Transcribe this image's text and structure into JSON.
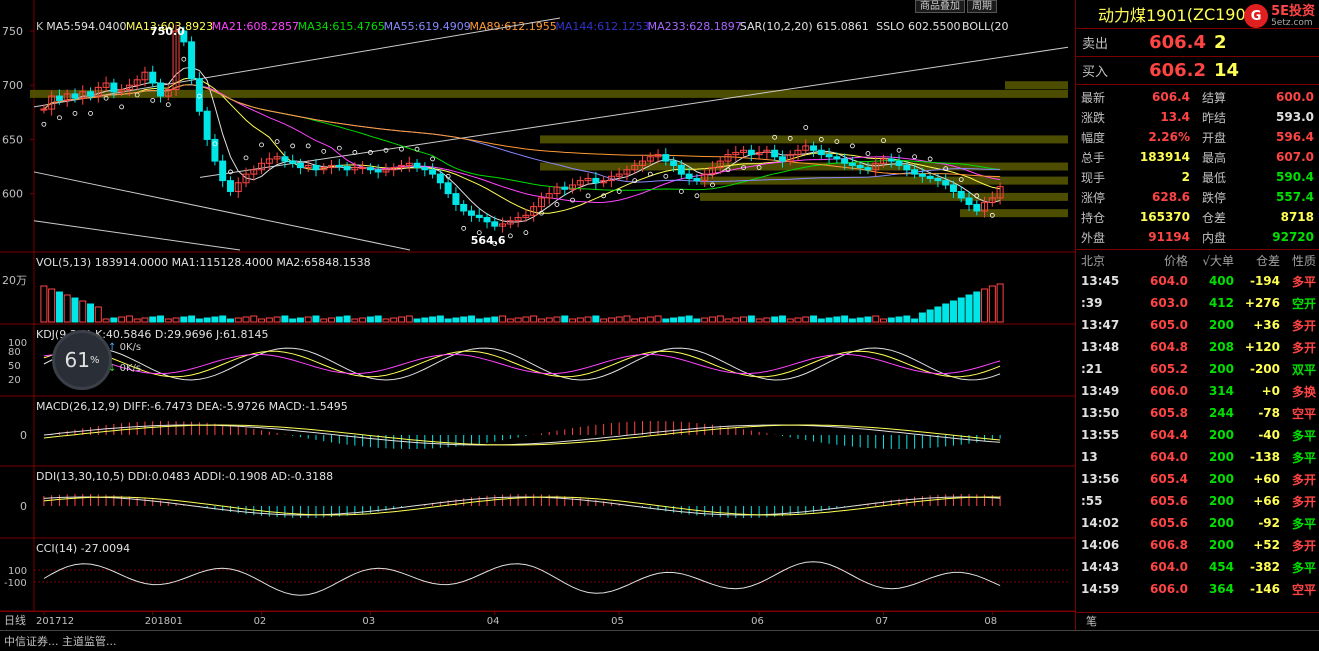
{
  "top_tabs": [
    "商品叠加",
    "周期"
  ],
  "instrument": {
    "name": "动力煤1901",
    "code": "(ZC1901)"
  },
  "logo": {
    "badge": "G",
    "text": "5E投资",
    "sub": "5etz.com"
  },
  "quotes": {
    "ask_label": "卖出",
    "ask_price": "606.4",
    "ask_vol": "2",
    "bid_label": "买入",
    "bid_price": "606.2",
    "bid_vol": "14"
  },
  "stats": [
    {
      "k1": "最新",
      "v1": "606.4",
      "c1": "red",
      "k2": "结算",
      "v2": "600.0",
      "c2": "red"
    },
    {
      "k1": "涨跌",
      "v1": "13.4",
      "c1": "red",
      "k2": "昨结",
      "v2": "593.0",
      "c2": "white"
    },
    {
      "k1": "幅度",
      "v1": "2.26%",
      "c1": "red",
      "k2": "开盘",
      "v2": "596.4",
      "c2": "red"
    },
    {
      "k1": "总手",
      "v1": "183914",
      "c1": "yellow",
      "k2": "最高",
      "v2": "607.0",
      "c2": "red"
    },
    {
      "k1": "现手",
      "v1": "2",
      "c1": "yellow",
      "k2": "最低",
      "v2": "590.4",
      "c2": "green"
    },
    {
      "k1": "涨停",
      "v1": "628.6",
      "c1": "red",
      "k2": "跌停",
      "v2": "557.4",
      "c2": "green"
    },
    {
      "k1": "持仓",
      "v1": "165370",
      "c1": "yellow",
      "k2": "仓差",
      "v2": "8718",
      "c2": "yellow"
    },
    {
      "k1": "外盘",
      "v1": "91194",
      "c1": "red",
      "k2": "内盘",
      "v2": "92720",
      "c2": "green"
    }
  ],
  "trade_header": {
    "time": "北京",
    "price": "价格",
    "vol": "√大单",
    "oi": "仓差",
    "nature": "性质"
  },
  "trades": [
    {
      "time": "13:45",
      "price": "604.0",
      "vol": "400",
      "oi": "-194",
      "nature": "多平",
      "pc": "red",
      "oc": "yellow",
      "nc": "red"
    },
    {
      "time": ":39",
      "price": "603.0",
      "vol": "412",
      "oi": "+276",
      "nature": "空开",
      "pc": "red",
      "oc": "yellow",
      "nc": "green"
    },
    {
      "time": "13:47",
      "price": "605.0",
      "vol": "200",
      "oi": "+36",
      "nature": "多开",
      "pc": "red",
      "oc": "yellow",
      "nc": "red"
    },
    {
      "time": "13:48",
      "price": "604.8",
      "vol": "208",
      "oi": "+120",
      "nature": "多开",
      "pc": "red",
      "oc": "yellow",
      "nc": "red"
    },
    {
      "time": ":21",
      "price": "605.2",
      "vol": "200",
      "oi": "-200",
      "nature": "双平",
      "pc": "red",
      "oc": "yellow",
      "nc": "green"
    },
    {
      "time": "13:49",
      "price": "606.0",
      "vol": "314",
      "oi": "+0",
      "nature": "多换",
      "pc": "red",
      "oc": "yellow",
      "nc": "red"
    },
    {
      "time": "13:50",
      "price": "605.8",
      "vol": "244",
      "oi": "-78",
      "nature": "空平",
      "pc": "red",
      "oc": "yellow",
      "nc": "red"
    },
    {
      "time": "13:55",
      "price": "604.4",
      "vol": "200",
      "oi": "-40",
      "nature": "多平",
      "pc": "red",
      "oc": "yellow",
      "nc": "green"
    },
    {
      "time": "13",
      "price": "604.0",
      "vol": "200",
      "oi": "-138",
      "nature": "多平",
      "pc": "red",
      "oc": "yellow",
      "nc": "green"
    },
    {
      "time": "13:56",
      "price": "605.4",
      "vol": "200",
      "oi": "+60",
      "nature": "多开",
      "pc": "red",
      "oc": "yellow",
      "nc": "red"
    },
    {
      "time": ":55",
      "price": "605.6",
      "vol": "200",
      "oi": "+66",
      "nature": "多开",
      "pc": "red",
      "oc": "yellow",
      "nc": "red"
    },
    {
      "time": "14:02",
      "price": "605.6",
      "vol": "200",
      "oi": "-92",
      "nature": "多平",
      "pc": "red",
      "oc": "yellow",
      "nc": "green"
    },
    {
      "time": "14:06",
      "price": "606.8",
      "vol": "200",
      "oi": "+52",
      "nature": "多开",
      "pc": "red",
      "oc": "yellow",
      "nc": "red"
    },
    {
      "time": "14:43",
      "price": "604.0",
      "vol": "454",
      "oi": "-382",
      "nature": "多平",
      "pc": "red",
      "oc": "yellow",
      "nc": "green"
    },
    {
      "time": "14:59",
      "price": "606.0",
      "vol": "364",
      "oi": "-146",
      "nature": "空平",
      "pc": "red",
      "oc": "yellow",
      "nc": "red"
    }
  ],
  "side_footer": "笔",
  "gauge": {
    "value": "61",
    "unit": "%",
    "up": "0K/s",
    "down": "0K/s"
  },
  "status_bar": "中信证券...  主道监管...",
  "period_label": "日线",
  "chart_data": [
    {
      "type": "candlestick",
      "title": "",
      "header": [
        {
          "text": "K",
          "color": "#c0c0c0"
        },
        {
          "text": "MA5:594.0400",
          "color": "#e0e0e0"
        },
        {
          "text": "MA13:603.8923",
          "color": "#ffff55"
        },
        {
          "text": "MA21:608.2857",
          "color": "#ff44ff"
        },
        {
          "text": "MA34:615.4765",
          "color": "#00dd00"
        },
        {
          "text": "MA55:619.4909",
          "color": "#8888ff"
        },
        {
          "text": "MA89:612.1955",
          "color": "#ff9933"
        },
        {
          "text": "MA144:612.1253",
          "color": "#3333cc"
        },
        {
          "text": "MA233:628.1897",
          "color": "#aa66ff"
        },
        {
          "text": "SAR(10,2,20) 615.0861",
          "color": "#e0e0e0"
        },
        {
          "text": "SSLO 602.5500",
          "color": "#e0e0e0"
        },
        {
          "text": "BOLL(20",
          "color": "#e0e0e0"
        }
      ],
      "yticks": [
        750,
        700,
        650,
        600
      ],
      "ylim": [
        548,
        762
      ],
      "x_labels": [
        "201712",
        "201801",
        "02",
        "03",
        "04",
        "05",
        "06",
        "07",
        "08"
      ],
      "annotations": [
        {
          "text": "750.0",
          "x": "201801"
        },
        {
          "text": "564.6",
          "x": "04"
        }
      ],
      "close_series": [
        678,
        690,
        686,
        692,
        688,
        694,
        690,
        698,
        702,
        694,
        696,
        700,
        705,
        712,
        702,
        690,
        696,
        750,
        740,
        706,
        676,
        650,
        630,
        612,
        602,
        610,
        618,
        622,
        628,
        632,
        634,
        630,
        628,
        624,
        626,
        622,
        624,
        626,
        625,
        622,
        624,
        624,
        622,
        620,
        622,
        624,
        626,
        628,
        624,
        622,
        618,
        610,
        600,
        590,
        584,
        580,
        578,
        574,
        570,
        572,
        575,
        578,
        580,
        588,
        596,
        600,
        606,
        604,
        608,
        612,
        614,
        610,
        612,
        616,
        618,
        622,
        626,
        630,
        634,
        636,
        630,
        626,
        618,
        614,
        612,
        618,
        624,
        630,
        636,
        638,
        640,
        636,
        638,
        640,
        634,
        630,
        636,
        640,
        644,
        640,
        636,
        634,
        632,
        628,
        626,
        624,
        622,
        628,
        632,
        630,
        626,
        622,
        618,
        616,
        614,
        612,
        608,
        602,
        596,
        590,
        584,
        592,
        596,
        606.4
      ]
    },
    {
      "type": "bar",
      "title": "",
      "header": "VOL(5,13) 183914.0000 MA1:115128.4000 MA2:65848.1538",
      "ytick": "20万"
    },
    {
      "type": "line",
      "title": "",
      "header": "KDJ(9,3,3) K:40.5846 D:29.9696 J:61.8145",
      "yticks": [
        100,
        80,
        50,
        20
      ]
    },
    {
      "type": "line",
      "title": "",
      "header": "MACD(26,12,9) DIFF:-6.7473 DEA:-5.9726 MACD:-1.5495",
      "yticks": [
        0
      ]
    },
    {
      "type": "line",
      "title": "",
      "header": "DDI(13,30,10,5) DDI:0.0483 ADDI:-0.1908 AD:-0.3188",
      "yticks": [
        0
      ]
    },
    {
      "type": "line",
      "title": "",
      "header": "CCI(14) -27.0094",
      "yticks": [
        100,
        -100
      ]
    }
  ]
}
